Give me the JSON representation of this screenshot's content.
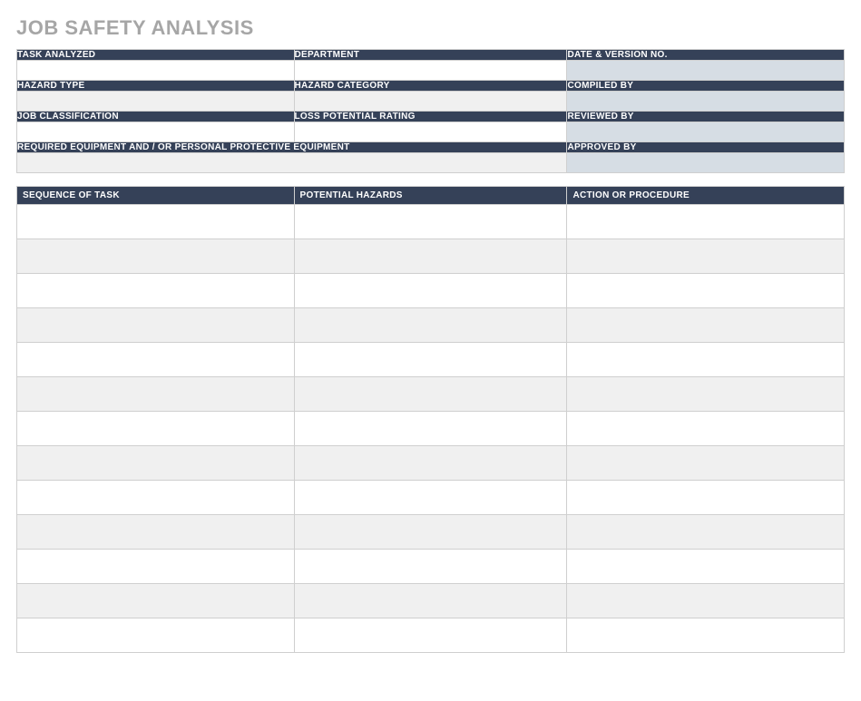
{
  "title": "JOB SAFETY ANALYSIS",
  "info": {
    "task_analyzed": {
      "label": "TASK ANALYZED",
      "value": ""
    },
    "department": {
      "label": "DEPARTMENT",
      "value": ""
    },
    "date_version": {
      "label": "DATE & VERSION NO.",
      "value": ""
    },
    "hazard_type": {
      "label": "HAZARD TYPE",
      "value": ""
    },
    "hazard_category": {
      "label": "HAZARD CATEGORY",
      "value": ""
    },
    "compiled_by": {
      "label": "COMPILED BY",
      "value": ""
    },
    "job_classification": {
      "label": "JOB CLASSIFICATION",
      "value": ""
    },
    "loss_potential": {
      "label": "LOSS POTENTIAL RATING",
      "value": ""
    },
    "reviewed_by": {
      "label": "REVIEWED BY",
      "value": ""
    },
    "required_equipment": {
      "label": "REQUIRED EQUIPMENT AND / OR PERSONAL PROTECTIVE EQUIPMENT",
      "value": ""
    },
    "approved_by": {
      "label": "APPROVED BY",
      "value": ""
    }
  },
  "sequence": {
    "headers": {
      "task": "SEQUENCE OF TASK",
      "hazards": "POTENTIAL HAZARDS",
      "action": "ACTION OR PROCEDURE"
    },
    "rows": [
      {
        "task": "",
        "hazards": "",
        "action": ""
      },
      {
        "task": "",
        "hazards": "",
        "action": ""
      },
      {
        "task": "",
        "hazards": "",
        "action": ""
      },
      {
        "task": "",
        "hazards": "",
        "action": ""
      },
      {
        "task": "",
        "hazards": "",
        "action": ""
      },
      {
        "task": "",
        "hazards": "",
        "action": ""
      },
      {
        "task": "",
        "hazards": "",
        "action": ""
      },
      {
        "task": "",
        "hazards": "",
        "action": ""
      },
      {
        "task": "",
        "hazards": "",
        "action": ""
      },
      {
        "task": "",
        "hazards": "",
        "action": ""
      },
      {
        "task": "",
        "hazards": "",
        "action": ""
      },
      {
        "task": "",
        "hazards": "",
        "action": ""
      },
      {
        "task": "",
        "hazards": "",
        "action": ""
      }
    ]
  }
}
